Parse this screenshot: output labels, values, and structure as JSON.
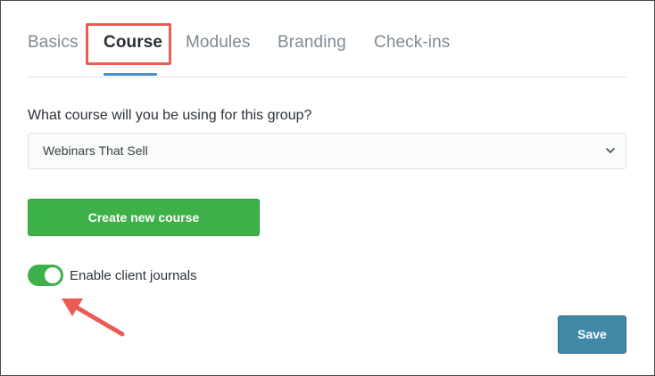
{
  "tabs": [
    {
      "label": "Basics",
      "active": false
    },
    {
      "label": "Course",
      "active": true
    },
    {
      "label": "Modules",
      "active": false
    },
    {
      "label": "Branding",
      "active": false
    },
    {
      "label": "Check-ins",
      "active": false
    }
  ],
  "course": {
    "question": "What course will you be using for this group?",
    "selected_course": "Webinars That Sell",
    "create_button_label": "Create new course"
  },
  "journals": {
    "toggle_label": "Enable client journals",
    "enabled": true
  },
  "footer": {
    "save_label": "Save"
  },
  "colors": {
    "highlight": "#ea5b52",
    "green": "#3db049",
    "save_blue": "#3f89a6",
    "tab_underline": "#4a90c8"
  },
  "icons": {
    "select_chevron": "chevron-down-icon",
    "annotation_arrow": "arrow-icon"
  }
}
